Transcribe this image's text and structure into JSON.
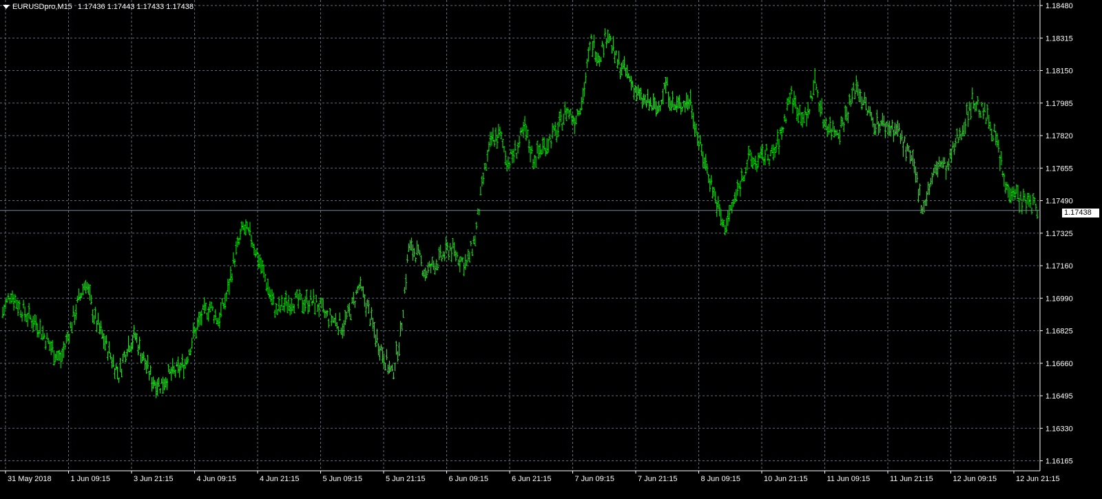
{
  "header": {
    "symbol_timeframe": "EURUSDpro,M15",
    "ohlc": "1.17436 1.17443 1.17433 1.17438"
  },
  "current_price": "1.17438",
  "colors": {
    "background": "#000000",
    "candles": "#00ff00",
    "grid": "#5f6e7a",
    "current_price_line": "#778899",
    "axis_text": "#ffffff"
  },
  "chart_data": {
    "type": "line",
    "title": "EURUSDpro,M15",
    "grid": true,
    "ylim": [
      1.1605,
      1.1855
    ],
    "y_ticks": [
      "1.18480",
      "1.18315",
      "1.18150",
      "1.17985",
      "1.17820",
      "1.17655",
      "1.17490",
      "1.17325",
      "1.17160",
      "1.16990",
      "1.16825",
      "1.16660",
      "1.16495",
      "1.16330",
      "1.16165"
    ],
    "x_ticks": [
      "31 May 2018",
      "1 Jun 09:15",
      "3 Jun 21:15",
      "4 Jun 09:15",
      "4 Jun 21:15",
      "5 Jun 09:15",
      "5 Jun 21:15",
      "6 Jun 09:15",
      "6 Jun 21:15",
      "7 Jun 09:15",
      "7 Jun 21:15",
      "8 Jun 09:15",
      "10 Jun 21:15",
      "11 Jun 09:15",
      "11 Jun 21:15",
      "12 Jun 09:15",
      "12 Jun 21:15"
    ],
    "series": [
      {
        "values": [
          1.1692,
          1.1702,
          1.1695,
          1.169,
          1.1687,
          1.168,
          1.1673,
          1.1668,
          1.1682,
          1.1696,
          1.1708,
          1.169,
          1.168,
          1.167,
          1.166,
          1.1675,
          1.168,
          1.1668,
          1.1658,
          1.1655,
          1.166,
          1.1662,
          1.1666,
          1.168,
          1.169,
          1.1695,
          1.1688,
          1.17,
          1.172,
          1.1735,
          1.173,
          1.1718,
          1.1705,
          1.1692,
          1.1696,
          1.1698,
          1.1697,
          1.1698,
          1.1696,
          1.169,
          1.1688,
          1.1685,
          1.1693,
          1.1705,
          1.1695,
          1.168,
          1.167,
          1.166,
          1.168,
          1.1725,
          1.1722,
          1.1712,
          1.1716,
          1.172,
          1.1725,
          1.172,
          1.1716,
          1.173,
          1.176,
          1.178,
          1.1782,
          1.1768,
          1.1775,
          1.1785,
          1.177,
          1.1775,
          1.178,
          1.1785,
          1.1795,
          1.179,
          1.1802,
          1.183,
          1.1822,
          1.1835,
          1.182,
          1.1815,
          1.1808,
          1.18,
          1.1798,
          1.1795,
          1.1808,
          1.1796,
          1.1798,
          1.18,
          1.1778,
          1.1765,
          1.175,
          1.1735,
          1.1745,
          1.1758,
          1.177,
          1.1768,
          1.1772,
          1.1772,
          1.1783,
          1.1803,
          1.1795,
          1.179,
          1.181,
          1.179,
          1.1785,
          1.1785,
          1.1795,
          1.1808,
          1.1798,
          1.1789,
          1.1788,
          1.1786,
          1.1785,
          1.1775,
          1.1765,
          1.1745,
          1.1758,
          1.1768,
          1.1765,
          1.1778,
          1.1788,
          1.18,
          1.1795,
          1.179,
          1.1778,
          1.1755,
          1.1755,
          1.1748,
          1.1748,
          1.1744
        ]
      }
    ]
  }
}
